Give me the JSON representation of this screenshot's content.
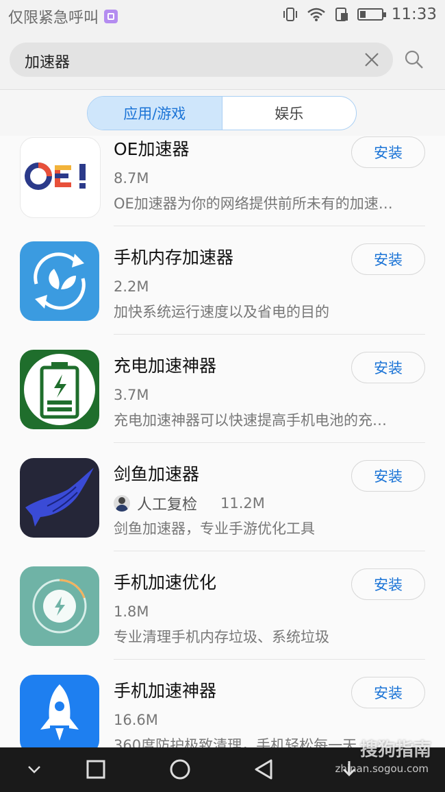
{
  "status_bar": {
    "carrier_text": "仅限紧急呼叫",
    "time": "11:33"
  },
  "search": {
    "query": "加速器"
  },
  "tabs": [
    {
      "label": "应用/游戏",
      "active": true
    },
    {
      "label": "娱乐",
      "active": false
    }
  ],
  "install_label": "安装",
  "apps": [
    {
      "name": "OE加速器",
      "size": "8.7M",
      "desc": "OE加速器为你的网络提供前所未有的加速…",
      "icon": "oe-logo-icon"
    },
    {
      "name": "手机内存加速器",
      "size": "2.2M",
      "desc": "加快系统运行速度以及省电的目的",
      "icon": "leaf-refresh-icon"
    },
    {
      "name": "充电加速神器",
      "size": "3.7M",
      "desc": "充电加速神器可以快速提高手机电池的充…",
      "icon": "battery-bolt-icon"
    },
    {
      "name": "剑鱼加速器",
      "badge": "人工复检",
      "size": "11.2M",
      "desc": "剑鱼加速器，专业手游优化工具",
      "icon": "swordfish-icon"
    },
    {
      "name": "手机加速优化",
      "size": "1.8M",
      "desc": "专业清理手机内存垃圾、系统垃圾",
      "icon": "bolt-ring-icon"
    },
    {
      "name": "手机加速神器",
      "size": "16.6M",
      "desc": "360度防护极致清理，手机轻松每一天",
      "icon": "rocket-icon"
    }
  ],
  "watermark": {
    "main": "搜狗指南",
    "sub": "zhinan.sogou.com"
  },
  "colors": {
    "accent": "#1a73d6",
    "tab_active_bg": "#cfe6fb",
    "navbar": "#1a1a1a"
  }
}
